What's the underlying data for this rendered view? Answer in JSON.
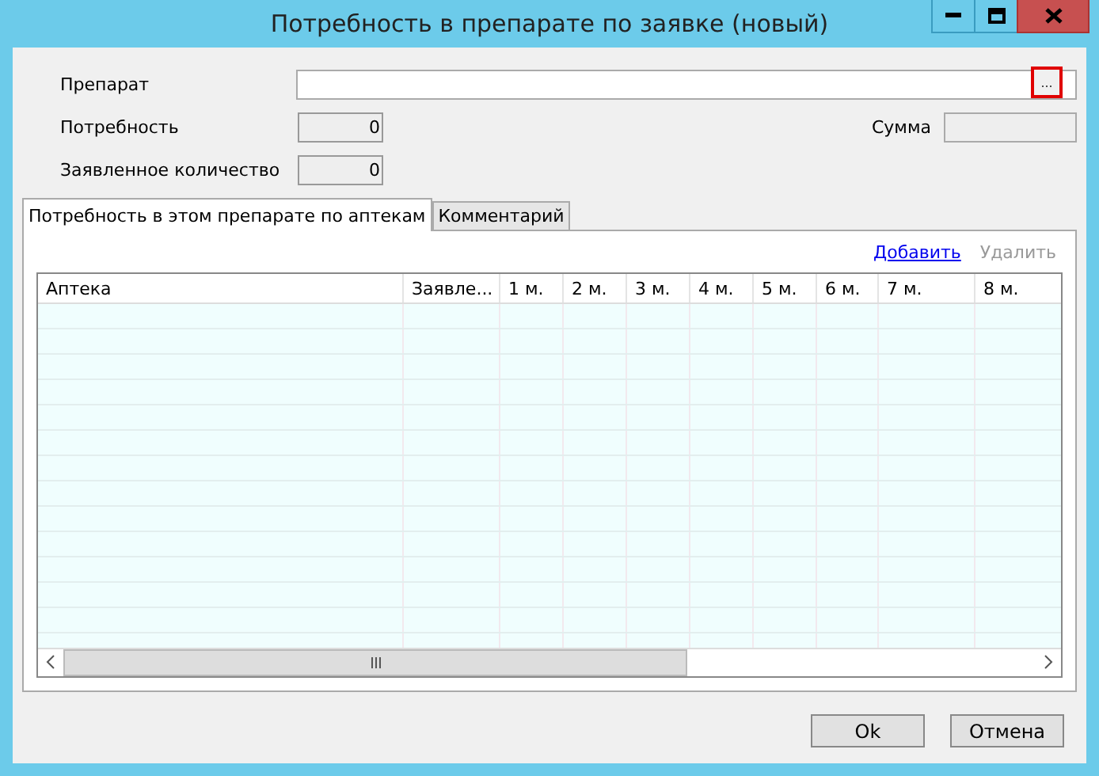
{
  "window": {
    "title": "Потребность в препарате по заявке (новый)"
  },
  "fields": [
    {
      "label": "Препарат",
      "kind": "lookup",
      "button": "..."
    },
    {
      "label": "Потребность",
      "kind": "number",
      "value": "0"
    },
    {
      "label": "Заявленное количество",
      "kind": "number",
      "value": "0"
    }
  ],
  "sum": {
    "label": "Сумма"
  },
  "tabs": [
    {
      "label": "Потребность в этом препарате по аптекам",
      "selected": true
    },
    {
      "label": "Комментарий",
      "selected": false
    }
  ],
  "links": [
    {
      "label": "Добавить",
      "disabled": false
    },
    {
      "label": "Удалить",
      "disabled": true
    }
  ],
  "table": {
    "columns": [
      "Аптека",
      "Заявле...",
      "1 м.",
      "2 м.",
      "3 м.",
      "4 м.",
      "5 м.",
      "6 м.",
      "7 м.",
      "8 м."
    ]
  },
  "buttons": [
    "Ok",
    "Отмена"
  ]
}
